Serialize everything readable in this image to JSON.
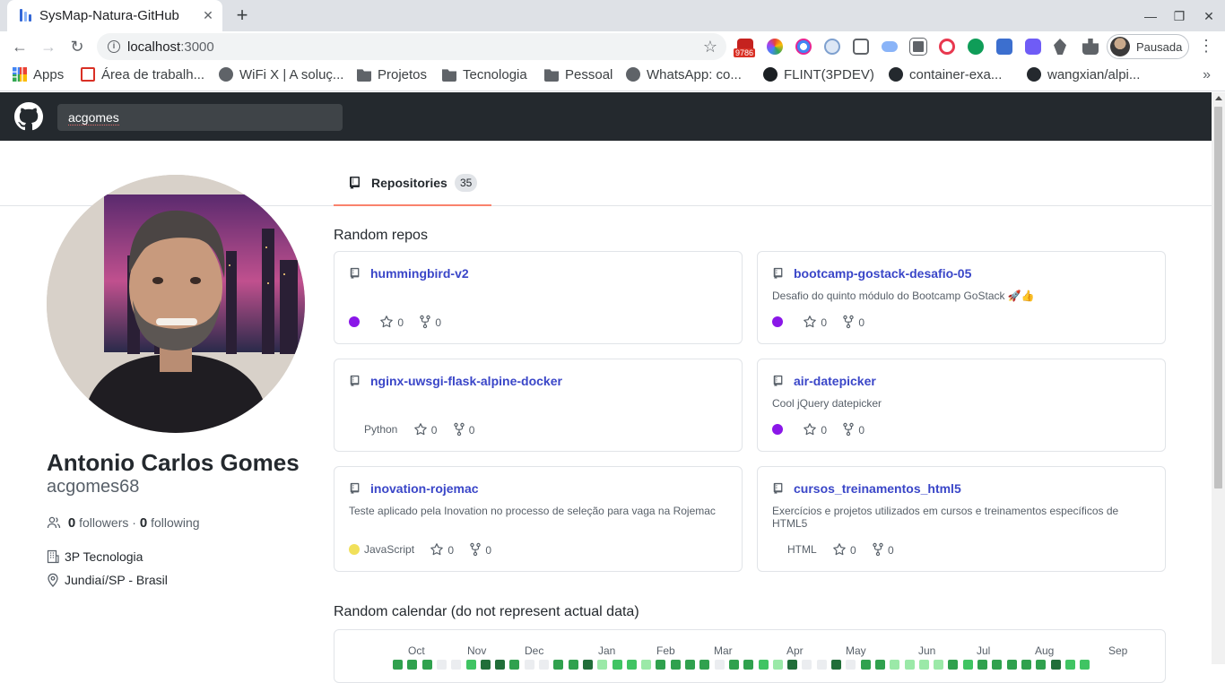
{
  "browser": {
    "tab_title": "SysMap-Natura-GitHub",
    "url_host": "localhost",
    "url_port": ":3000",
    "profile_label": "Pausada",
    "gmail_badge": "9786",
    "bookmarks": [
      {
        "label": "Apps",
        "icon": "apps-icon"
      },
      {
        "label": "Área de trabalh...",
        "icon": "page-icon"
      },
      {
        "label": "WiFi X | A soluç...",
        "icon": "globe-icon"
      },
      {
        "label": "Projetos",
        "icon": "folder-icon"
      },
      {
        "label": "Tecnologia",
        "icon": "folder-icon"
      },
      {
        "label": "Pessoal",
        "icon": "folder-icon"
      },
      {
        "label": "WhatsApp: co...",
        "icon": "globe-icon"
      },
      {
        "label": "FLINT(3PDEV)",
        "icon": "flint-icon"
      },
      {
        "label": "container-exa...",
        "icon": "github-icon"
      },
      {
        "label": "wangxian/alpi...",
        "icon": "github-icon"
      }
    ]
  },
  "header": {
    "search_value": "acgomes"
  },
  "profile": {
    "name": "Antonio Carlos Gomes",
    "login": "acgomes68",
    "followers_count": "0",
    "followers_label": "followers",
    "separator": "·",
    "following_count": "0",
    "following_label": "following",
    "company": "3P Tecnologia",
    "location": "Jundiaí/SP - Brasil"
  },
  "tabs": {
    "repositories_label": "Repositories",
    "repositories_count": "35"
  },
  "random_repos_title": "Random repos",
  "repos": [
    {
      "name": "hummingbird-v2",
      "description": "",
      "language": "",
      "lang_color": "#8a17e8",
      "stars": "0",
      "forks": "0"
    },
    {
      "name": "bootcamp-gostack-desafio-05",
      "description": "Desafio do quinto módulo do Bootcamp GoStack 🚀👍",
      "language": "",
      "lang_color": "#8a17e8",
      "stars": "0",
      "forks": "0"
    },
    {
      "name": "nginx-uwsgi-flask-alpine-docker",
      "description": "",
      "language": "Python",
      "lang_color": "",
      "stars": "0",
      "forks": "0"
    },
    {
      "name": "air-datepicker",
      "description": "Cool jQuery datepicker",
      "language": "",
      "lang_color": "#8a17e8",
      "stars": "0",
      "forks": "0"
    },
    {
      "name": "inovation-rojemac",
      "description": "Teste aplicado pela Inovation no processo de seleção para vaga na Rojemac",
      "language": "JavaScript",
      "lang_color": "#f1e05a",
      "stars": "0",
      "forks": "0"
    },
    {
      "name": "cursos_treinamentos_html5",
      "description": "Exercícios e projetos utilizados em cursos e treinamentos específicos de HTML5",
      "language": "HTML",
      "lang_color": "",
      "stars": "0",
      "forks": "0"
    }
  ],
  "calendar": {
    "title": "Random calendar (do not represent actual data)",
    "months": [
      "Oct",
      "Nov",
      "Dec",
      "Jan",
      "Feb",
      "Mar",
      "Apr",
      "May",
      "Jun",
      "Jul",
      "Aug",
      "Sep"
    ],
    "levels": [
      3,
      3,
      3,
      0,
      0,
      2,
      4,
      4,
      3,
      0,
      0,
      3,
      3,
      4,
      1,
      2,
      2,
      1,
      3,
      3,
      3,
      3,
      0,
      3,
      3,
      2,
      1,
      4,
      0,
      0,
      4,
      0,
      3,
      3,
      1,
      1,
      1,
      1,
      3,
      2,
      3,
      3,
      3,
      3,
      3,
      4,
      2,
      2
    ],
    "level_colors": [
      "#ebedf0",
      "#9be9a8",
      "#40c463",
      "#30a14e",
      "#216e39"
    ]
  }
}
